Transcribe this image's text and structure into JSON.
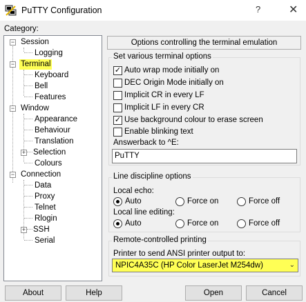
{
  "window": {
    "title": "PuTTY Configuration",
    "help": "?",
    "close": "✕"
  },
  "category": {
    "label": "Category:",
    "items": [
      {
        "label": "Session",
        "expander": "−"
      },
      {
        "label": "Logging"
      },
      {
        "label": "Terminal",
        "expander": "−",
        "highlighted": true
      },
      {
        "label": "Keyboard"
      },
      {
        "label": "Bell"
      },
      {
        "label": "Features"
      },
      {
        "label": "Window",
        "expander": "−"
      },
      {
        "label": "Appearance"
      },
      {
        "label": "Behaviour"
      },
      {
        "label": "Translation"
      },
      {
        "label": "Selection",
        "expander": "+"
      },
      {
        "label": "Colours"
      },
      {
        "label": "Connection",
        "expander": "−"
      },
      {
        "label": "Data"
      },
      {
        "label": "Proxy"
      },
      {
        "label": "Telnet"
      },
      {
        "label": "Rlogin"
      },
      {
        "label": "SSH",
        "expander": "+"
      },
      {
        "label": "Serial"
      }
    ]
  },
  "header": "Options controlling the terminal emulation",
  "terminal_options": {
    "title": "Set various terminal options",
    "checkboxes": [
      {
        "label": "Auto wrap mode initially on",
        "checked": true
      },
      {
        "label": "DEC Origin Mode initially on",
        "checked": false
      },
      {
        "label": "Implicit CR in every LF",
        "checked": false
      },
      {
        "label": "Implicit LF in every CR",
        "checked": false
      },
      {
        "label": "Use background colour to erase screen",
        "checked": true
      },
      {
        "label": "Enable blinking text",
        "checked": false
      }
    ],
    "answerback_label": "Answerback to ^E:",
    "answerback_value": "PuTTY",
    "check_glyph": "✓"
  },
  "line_discipline": {
    "title": "Line discipline options",
    "local_echo_label": "Local echo:",
    "local_editing_label": "Local line editing:",
    "options": [
      "Auto",
      "Force on",
      "Force off"
    ],
    "local_echo_selected": "Auto",
    "local_editing_selected": "Auto"
  },
  "printing": {
    "title": "Remote-controlled printing",
    "printer_label": "Printer to send ANSI printer output to:",
    "printer_value": "NPIC4A35C (HP Color LaserJet M254dw)",
    "arrow": "⌄"
  },
  "buttons": {
    "about": "About",
    "help": "Help",
    "open": "Open",
    "cancel": "Cancel"
  },
  "colors": {
    "highlight": "#ffff55",
    "background": "#f0f0f0"
  }
}
